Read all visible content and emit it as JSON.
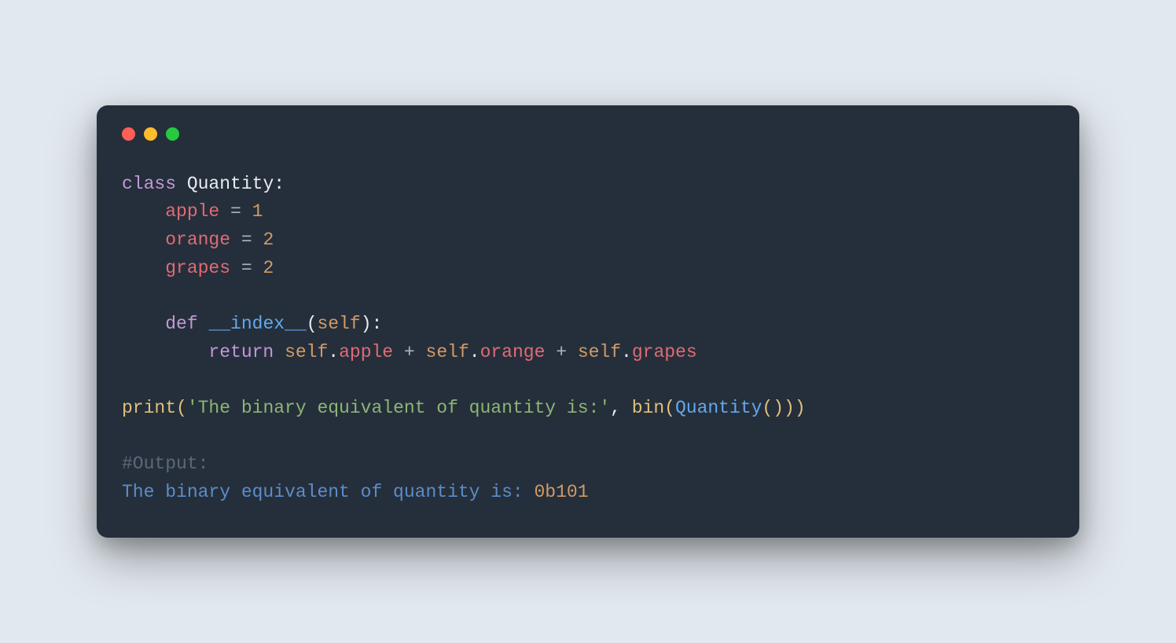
{
  "code": {
    "class_kw": "class",
    "class_name": "Quantity",
    "colon": ":",
    "apple_var": "apple",
    "eq": " = ",
    "apple_val": "1",
    "orange_var": "orange",
    "orange_val": "2",
    "grapes_var": "grapes",
    "grapes_val": "2",
    "def_kw": "def",
    "method_name": "__index__",
    "self_param": "self",
    "return_kw": "return",
    "self1": "self",
    "dot": ".",
    "apple_attr": "apple",
    "plus": " + ",
    "self2": "self",
    "orange_attr": "orange",
    "self3": "self",
    "grapes_attr": "grapes",
    "print_fn": "print",
    "str_literal": "'The binary equivalent of quantity is:'",
    "comma": ", ",
    "bin_fn": "bin",
    "call_class": "Quantity",
    "lparen": "(",
    "rparen": ")",
    "comment": "#Output:",
    "output_text": "The binary equivalent of quantity is: ",
    "output_val": "0b101"
  }
}
